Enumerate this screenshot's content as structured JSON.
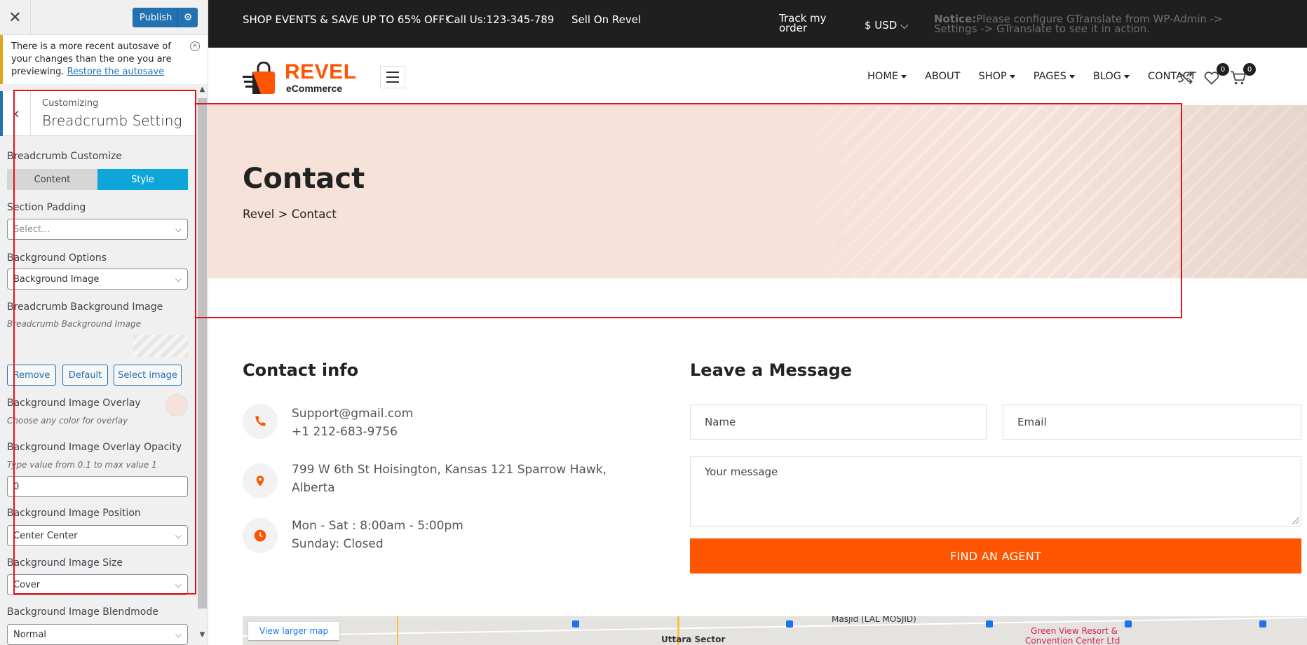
{
  "customizer": {
    "close_icon": "close-icon",
    "publish_label": "Publish",
    "notice": {
      "text": "There is a more recent autosave of your changes than the one you are previewing.",
      "link": "Restore the autosave"
    },
    "section": {
      "kicker": "Customizing",
      "title": "Breadcrumb Setting"
    },
    "fields": {
      "customize_label": "Breadcrumb Customize",
      "tab_content": "Content",
      "tab_style": "Style",
      "padding_label": "Section Padding",
      "padding_value": "Select...",
      "bg_options_label": "Background Options",
      "bg_options_value": "Background Image",
      "bg_image_label": "Breadcrumb Background Image",
      "bg_image_desc": "Breadcrumb Background Image",
      "btn_remove": "Remove",
      "btn_default": "Default",
      "btn_select": "Select image",
      "overlay_label": "Background Image Overlay",
      "overlay_desc": "Choose any color for overlay",
      "overlay_color": "#f7e2da",
      "opacity_label": "Background Image Overlay Opacity",
      "opacity_desc": "Type value from 0.1 to max value 1",
      "opacity_value": "0",
      "position_label": "Background Image Position",
      "position_value": "Center Center",
      "size_label": "Background Image Size",
      "size_value": "Cover",
      "blend_label": "Background Image Blendmode",
      "blend_value": "Normal"
    }
  },
  "site": {
    "topbar": {
      "promo": "SHOP EVENTS & SAVE UP TO 65% OFF!",
      "call": "Call Us:123-345-789",
      "sell": "Sell On Revel",
      "track": "Track my order",
      "currency": "$ USD",
      "notice_bold": "Notice:",
      "notice_text": "Please configure GTranslate from WP-Admin -> Settings -> GTranslate to see it in action."
    },
    "logo": {
      "name": "REVEL",
      "sub": "eCommerce"
    },
    "nav": [
      "HOME",
      "ABOUT",
      "SHOP",
      "PAGES",
      "BLOG",
      "CONTACT"
    ],
    "wishlist_count": "0",
    "cart_count": "0",
    "hero": {
      "title": "Contact",
      "crumb_home": "Revel",
      "crumb_sep": ">",
      "crumb_current": "Contact",
      "bg_color": "#f7e2da"
    },
    "contact_info": {
      "title": "Contact info",
      "email": "Support@gmail.com",
      "phone": "+1 212-683-9756",
      "address": "799 W 6th St Hoisington, Kansas 121 Sparrow Hawk,",
      "address2": "Alberta",
      "hours1": "Mon - Sat : 8:00am - 5:00pm",
      "hours2": "Sunday: Closed"
    },
    "form": {
      "title": "Leave a Message",
      "name_placeholder": "Name",
      "email_placeholder": "Email",
      "message_placeholder": "Your message",
      "submit": "FIND AN AGENT"
    },
    "map": {
      "view_larger": "View larger map",
      "label1": "Uttara Sector",
      "label2": "Masjid (LAL MOSJID)",
      "label3": "Green View Resort &",
      "label4": "Convention Center Ltd"
    },
    "accent": "#ff5400"
  }
}
